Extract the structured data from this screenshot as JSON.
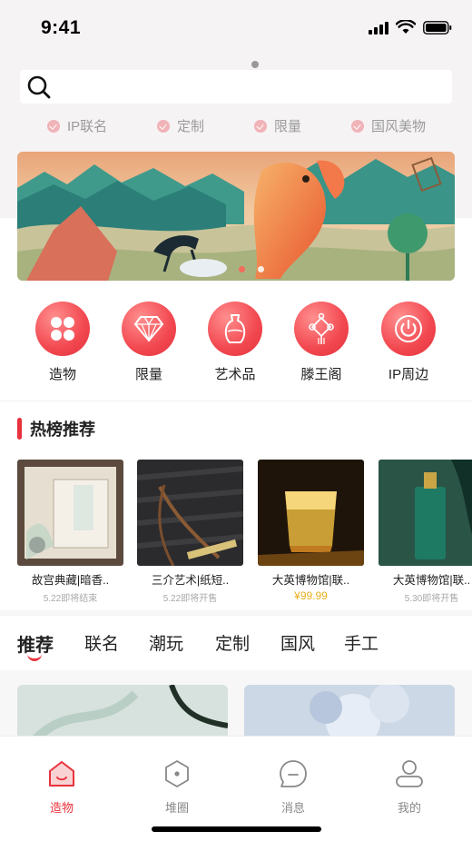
{
  "status_bar": {
    "time": "9:41"
  },
  "search": {
    "placeholder": ""
  },
  "tags": [
    {
      "label": "IP联名"
    },
    {
      "label": "定制"
    },
    {
      "label": "限量"
    },
    {
      "label": "国风美物"
    }
  ],
  "categories": [
    {
      "label": "造物",
      "icon": "clover-icon"
    },
    {
      "label": "限量",
      "icon": "diamond-icon"
    },
    {
      "label": "艺术品",
      "icon": "vase-icon"
    },
    {
      "label": "滕王阁",
      "icon": "chinese-knot-icon"
    },
    {
      "label": "IP周边",
      "icon": "power-icon"
    }
  ],
  "hot_section": {
    "title": "热榜推荐"
  },
  "products": [
    {
      "title": "故宫典藏|暗香..",
      "sub": "5.22即将结束",
      "price": ""
    },
    {
      "title": "三介艺术|纸短..",
      "sub": "5.22即将开售",
      "price": ""
    },
    {
      "title": "大英博物馆|联..",
      "sub": "",
      "price": "¥99.99"
    },
    {
      "title": "大英博物馆|联..",
      "sub": "5.30即将开售",
      "price": ""
    }
  ],
  "feed_tabs": [
    {
      "label": "推荐"
    },
    {
      "label": "联名"
    },
    {
      "label": "潮玩"
    },
    {
      "label": "定制"
    },
    {
      "label": "国风"
    },
    {
      "label": "手工"
    }
  ],
  "bottom_nav": [
    {
      "label": "造物",
      "icon": "home-icon"
    },
    {
      "label": "堆圈",
      "icon": "hexagon-icon"
    },
    {
      "label": "消息",
      "icon": "message-icon"
    },
    {
      "label": "我的",
      "icon": "user-icon"
    }
  ],
  "colors": {
    "accent": "#e8323c",
    "price": "#e9b021"
  }
}
